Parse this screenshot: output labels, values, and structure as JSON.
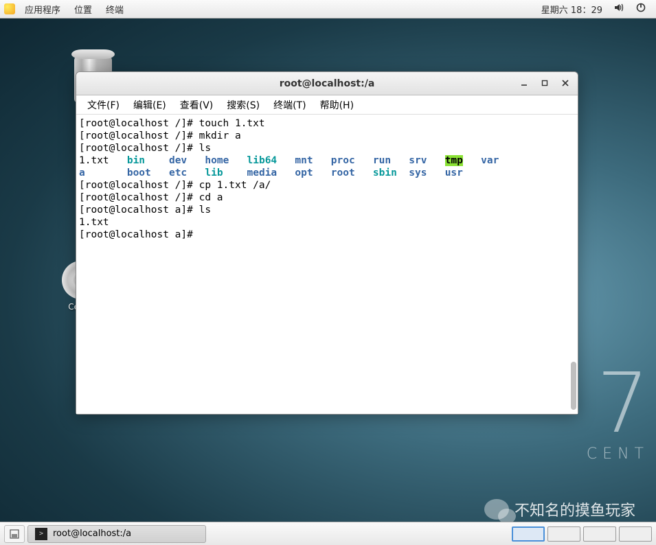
{
  "top_panel": {
    "menu": [
      "应用程序",
      "位置",
      "终端"
    ],
    "clock": "星期六 18：29"
  },
  "desktop": {
    "trash_label": "",
    "cd_label": "CentO",
    "centos_big": "7",
    "centos_text": "CENT"
  },
  "watermark": "不知名的摸鱼玩家",
  "window": {
    "title": "root@localhost:/a",
    "menus": [
      "文件(F)",
      "编辑(E)",
      "查看(V)",
      "搜索(S)",
      "终端(T)",
      "帮助(H)"
    ]
  },
  "terminal": {
    "lines": [
      {
        "prompt": "[root@localhost /]# ",
        "cmd": "touch 1.txt"
      },
      {
        "prompt": "[root@localhost /]# ",
        "cmd": "mkdir a"
      },
      {
        "prompt": "[root@localhost /]# ",
        "cmd": "ls"
      }
    ],
    "ls_row1": [
      {
        "t": "1.txt",
        "c": ""
      },
      {
        "t": "bin",
        "c": "cyan"
      },
      {
        "t": "dev",
        "c": "blue"
      },
      {
        "t": "home",
        "c": "blue"
      },
      {
        "t": "lib64",
        "c": "cyan"
      },
      {
        "t": "mnt",
        "c": "blue"
      },
      {
        "t": "proc",
        "c": "blue"
      },
      {
        "t": "run",
        "c": "blue"
      },
      {
        "t": "srv",
        "c": "blue"
      },
      {
        "t": "tmp",
        "c": "hl"
      },
      {
        "t": "var",
        "c": "blue"
      }
    ],
    "ls_row2": [
      {
        "t": "a",
        "c": "blue"
      },
      {
        "t": "boot",
        "c": "blue"
      },
      {
        "t": "etc",
        "c": "blue"
      },
      {
        "t": "lib",
        "c": "cyan"
      },
      {
        "t": "media",
        "c": "blue"
      },
      {
        "t": "opt",
        "c": "blue"
      },
      {
        "t": "root",
        "c": "blue"
      },
      {
        "t": "sbin",
        "c": "cyan"
      },
      {
        "t": "sys",
        "c": "blue"
      },
      {
        "t": "usr",
        "c": "blue"
      }
    ],
    "lines2": [
      {
        "prompt": "[root@localhost /]# ",
        "cmd": "cp 1.txt /a/"
      },
      {
        "prompt": "[root@localhost /]# ",
        "cmd": "cd a"
      },
      {
        "prompt": "[root@localhost a]# ",
        "cmd": "ls"
      }
    ],
    "output2": "1.txt",
    "final_prompt": "[root@localhost a]# "
  },
  "taskbar": {
    "item": "root@localhost:/a"
  }
}
